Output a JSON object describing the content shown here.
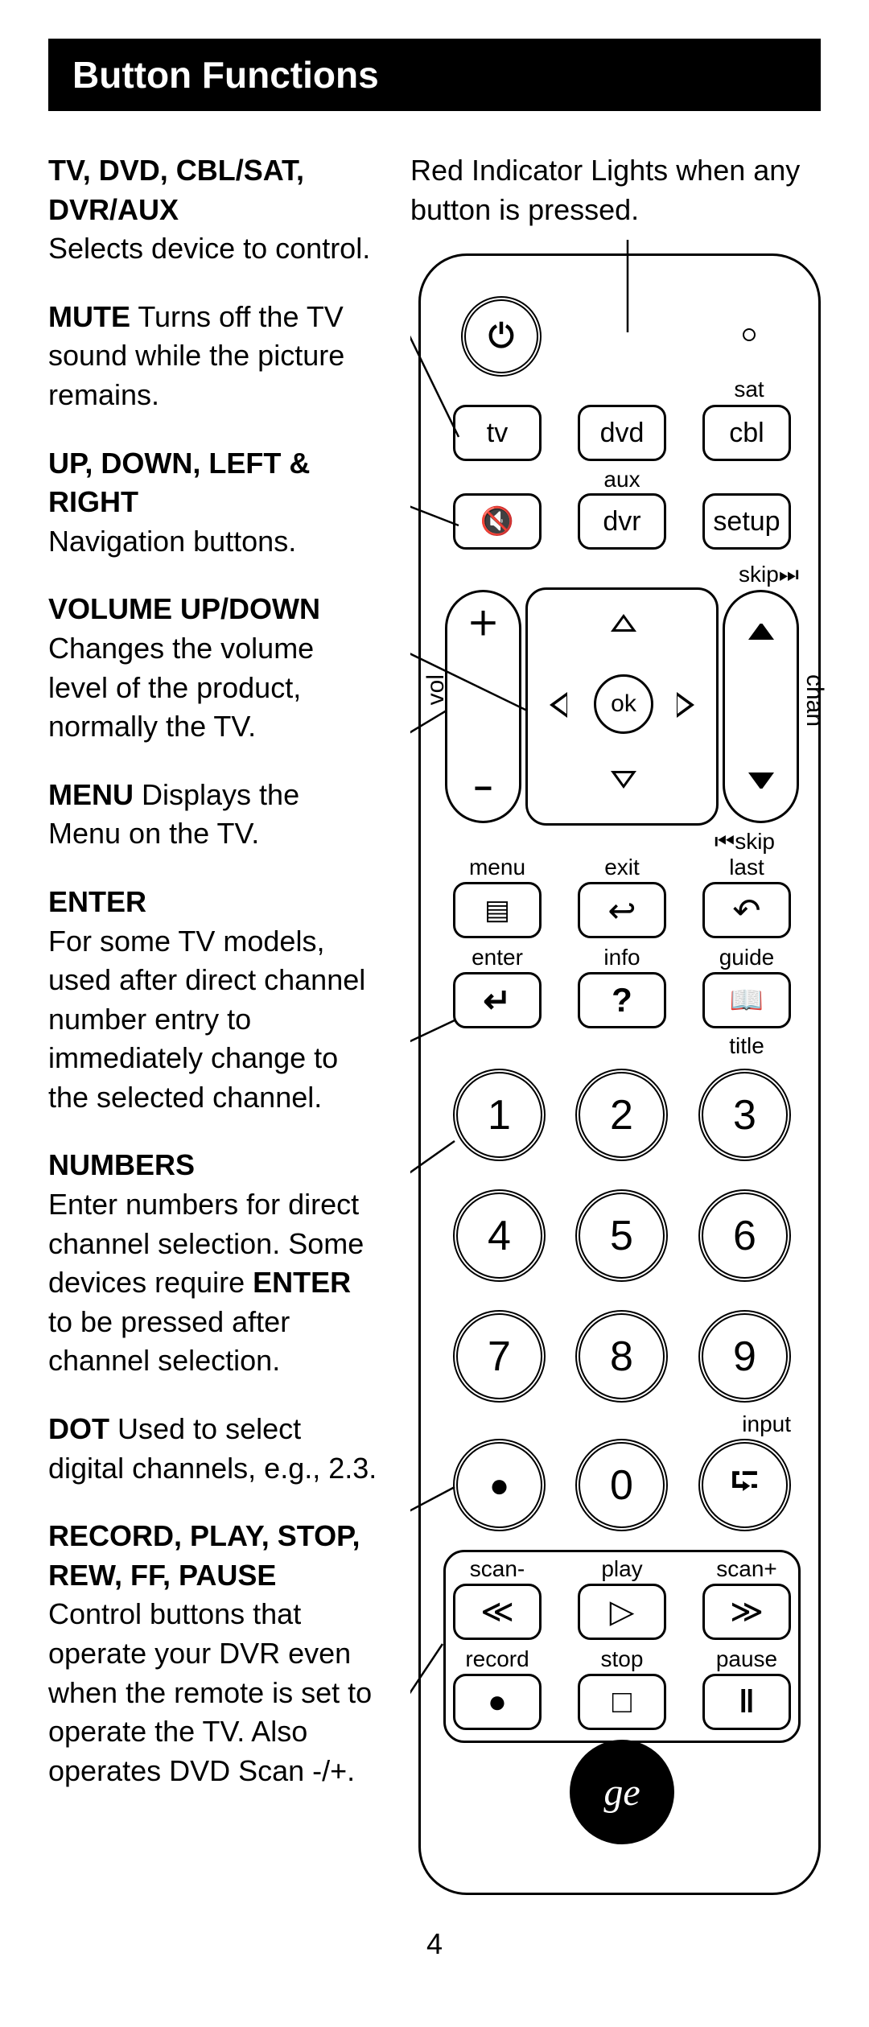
{
  "title": "Button Functions",
  "page_number": "4",
  "indicator_note": "Red Indicator Lights when any button is pressed.",
  "descriptions": {
    "device": {
      "heading": "TV, DVD, CBL/SAT, DVR/AUX",
      "body": "Selects device to control."
    },
    "mute": {
      "heading": "MUTE",
      "body": " Turns off the TV sound while the picture remains."
    },
    "nav": {
      "heading": "UP, DOWN, LEFT & RIGHT",
      "body": "Navigation buttons."
    },
    "vol": {
      "heading": "VOLUME UP/DOWN",
      "body": "Changes the volume level of the product, normally the TV."
    },
    "menu": {
      "heading": "MENU",
      "body": " Displays the Menu on the TV."
    },
    "enter": {
      "heading": "ENTER",
      "body": "For some TV models, used after direct channel number entry to immediately change to the selected channel."
    },
    "numbers": {
      "heading": "NUMBERS",
      "body_a": "Enter numbers for direct channel selection. Some devices require ",
      "body_b": "ENTER",
      "body_c": " to be pressed after channel selection."
    },
    "dot": {
      "heading": "DOT",
      "body": " Used to select digital channels, e.g., 2.3."
    },
    "transport": {
      "heading": "RECORD, PLAY, STOP, REW, FF, PAUSE",
      "body": "Control buttons that operate your DVR even when the remote is set to operate the TV. Also operates DVD Scan -/+."
    }
  },
  "remote": {
    "labels": {
      "sat": "sat",
      "aux": "aux",
      "skip_fwd": "skip⏭",
      "skip_back": "⏮skip",
      "vol": "vol",
      "chan": "chan",
      "menu": "menu",
      "exit": "exit",
      "last": "last",
      "enter": "enter",
      "info": "info",
      "guide": "guide",
      "title": "title",
      "input": "input",
      "scan_minus": "scan-",
      "play": "play",
      "scan_plus": "scan+",
      "record": "record",
      "stop": "stop",
      "pause": "pause"
    },
    "buttons": {
      "tv": "tv",
      "dvd": "dvd",
      "cbl": "cbl",
      "dvr": "dvr",
      "setup": "setup",
      "ok": "ok",
      "n1": "1",
      "n2": "2",
      "n3": "3",
      "n4": "4",
      "n5": "5",
      "n6": "6",
      "n7": "7",
      "n8": "8",
      "n9": "9",
      "n0": "0"
    },
    "icons": {
      "power": "⏻",
      "mute": "🔇",
      "plus": "＋",
      "minus": "−",
      "chan_up": "△",
      "chan_down": "▽",
      "menu_icon": "▤",
      "back": "↩",
      "undo": "↶",
      "enter_icon": "↵",
      "info_icon": "?",
      "guide_icon": "📖",
      "dot": "●",
      "input_icon": "⮓",
      "rew": "≪",
      "play_icon": "▷",
      "ff": "≫",
      "rec": "●",
      "stop_icon": "□",
      "pause_icon": "‖"
    }
  }
}
